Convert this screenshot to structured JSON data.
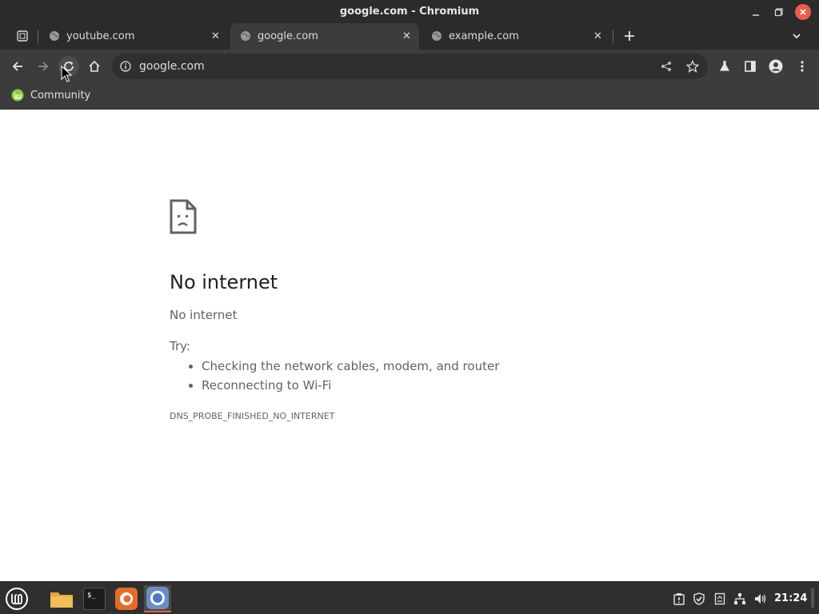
{
  "window": {
    "title": "google.com - Chromium"
  },
  "tabs": [
    {
      "label": "youtube.com",
      "active": false
    },
    {
      "label": "google.com",
      "active": true
    },
    {
      "label": "example.com",
      "active": false
    }
  ],
  "omnibox": {
    "url": "google.com"
  },
  "bookmarks": [
    {
      "label": "Community"
    }
  ],
  "error_page": {
    "heading": "No internet",
    "summary": "No internet",
    "try_label": "Try:",
    "suggestions": [
      "Checking the network cables, modem, and router",
      "Reconnecting to Wi-Fi"
    ],
    "error_code": "DNS_PROBE_FINISHED_NO_INTERNET"
  },
  "taskbar": {
    "apps": [
      "mint-menu-icon",
      "files-icon",
      "terminal-icon",
      "firefox-icon",
      "chromium-icon"
    ],
    "clock": "21:24"
  },
  "colors": {
    "titlebar": "#2b2b2b",
    "toolbar": "#3c3c3c",
    "close_button": "#e85e4b",
    "taskbar": "#2f2f2f",
    "accent": "#e0623e"
  }
}
